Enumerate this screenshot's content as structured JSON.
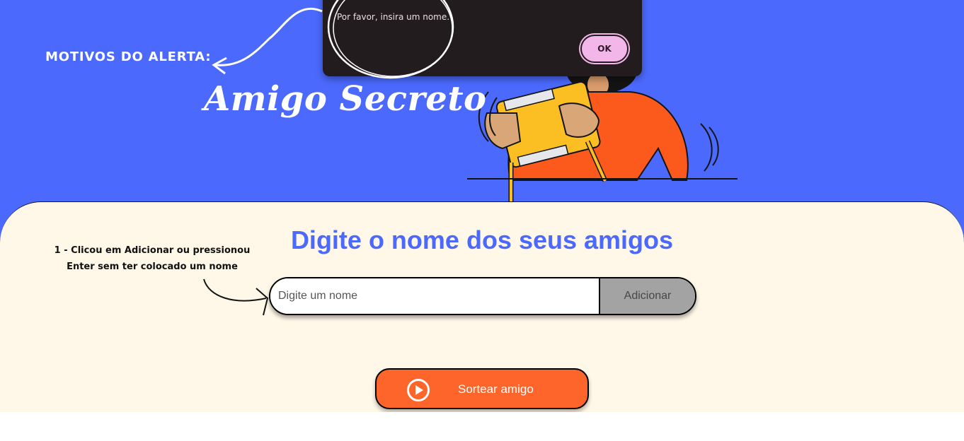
{
  "header": {
    "title": "Amigo Secreto",
    "annotation": "MOTIVOS DO ALERTA:"
  },
  "alert_dialog": {
    "message": "Por favor, insira um nome.",
    "ok_label": "OK"
  },
  "main": {
    "section_title": "Digite o nome dos seus amigos",
    "annotation_line1": "1 - Clicou em Adicionar ou pressionou",
    "annotation_line2": "Enter sem ter colocado um nome",
    "input": {
      "placeholder": "Digite um nome",
      "value": ""
    },
    "add_button_label": "Adicionar",
    "draw_button_label": "Sortear amigo"
  },
  "colors": {
    "header_bg": "#4b69fd",
    "main_bg": "#fff7e8",
    "title_blue": "#4b69fd",
    "draw_button": "#fe652b",
    "add_button": "#a3a3a3",
    "dialog_bg": "#231c1e",
    "dialog_ok": "#f3b6e9"
  },
  "icons": {
    "draw_button_icon": "play-circle-icon"
  }
}
